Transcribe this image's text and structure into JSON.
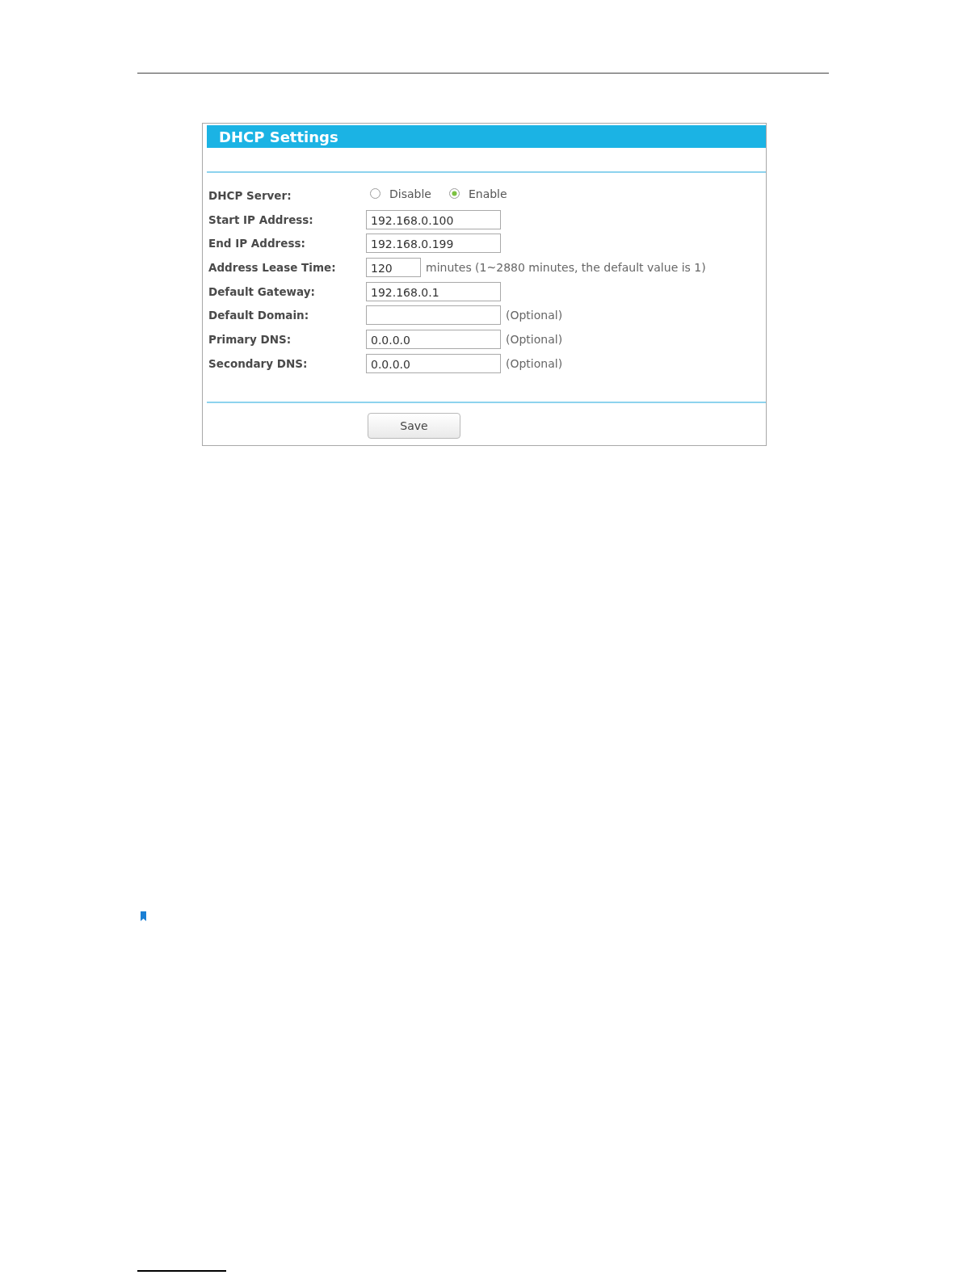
{
  "panel": {
    "title": "DHCP Settings",
    "fields": [
      {
        "kind": "radio",
        "label": "DHCP Server:",
        "options": [
          {
            "label": "Disable",
            "selected": false
          },
          {
            "label": "Enable",
            "selected": true
          }
        ]
      },
      {
        "kind": "text",
        "label": "Start IP Address:",
        "value": "192.168.0.100"
      },
      {
        "kind": "text",
        "label": "End IP Address:",
        "value": "192.168.0.199"
      },
      {
        "kind": "short",
        "label": "Address Lease Time:",
        "value": "120",
        "note": "minutes (1~2880 minutes, the default value is 1)"
      },
      {
        "kind": "text",
        "label": "Default Gateway:",
        "value": "192.168.0.1"
      },
      {
        "kind": "text",
        "label": "Default Domain:",
        "note": "(Optional)"
      },
      {
        "kind": "text",
        "label": "Primary DNS:",
        "value": "0.0.0.0",
        "note": "(Optional)"
      },
      {
        "kind": "text",
        "label": "Secondary DNS:",
        "value": "0.0.0.0",
        "note": "(Optional)"
      }
    ],
    "save_button": "Save"
  }
}
